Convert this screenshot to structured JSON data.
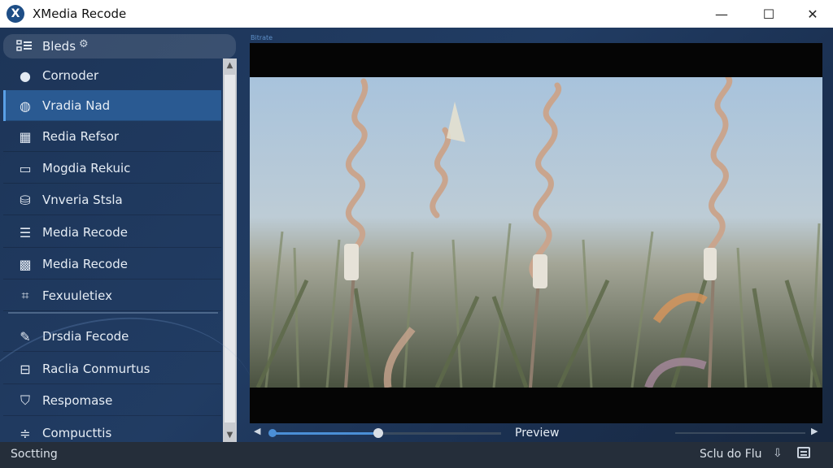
{
  "window": {
    "title": "XMedia Recode",
    "logo_glyph": "X",
    "controls": {
      "minimize": "—",
      "maximize": "☐",
      "close": "✕"
    }
  },
  "sidebar": {
    "header": {
      "label": "Bleds",
      "icon": "list-icon",
      "gear_icon": "gear-icon"
    },
    "items": [
      {
        "label": "Cornoder",
        "icon": "circle-icon",
        "glyph": "●"
      },
      {
        "label": "Vradia Nad",
        "icon": "sphere-icon",
        "glyph": "◍",
        "active": true
      },
      {
        "label": "Redia Refsor",
        "icon": "grid-icon",
        "glyph": "▦"
      },
      {
        "label": "Mogdia Rekuic",
        "icon": "monitor-icon",
        "glyph": "▭"
      },
      {
        "label": "Vnveria Stsla",
        "icon": "database-icon",
        "glyph": "⛁"
      },
      {
        "label": "Media Recode",
        "icon": "layers-icon",
        "glyph": "☰"
      },
      {
        "label": "Media Recode",
        "icon": "tiles-icon",
        "glyph": "▩"
      },
      {
        "label": "Fexuuletiex",
        "icon": "chip-icon",
        "glyph": "⌗"
      },
      {
        "label": "Drsdia Fecode",
        "icon": "wrench-icon",
        "glyph": "✎"
      },
      {
        "label": "Raclia Conmurtus",
        "icon": "drive-icon",
        "glyph": "⊟"
      },
      {
        "label": "Respomase",
        "icon": "shield-icon",
        "glyph": "⛉"
      },
      {
        "label": "Compucttis",
        "icon": "sliders-icon",
        "glyph": "≑"
      }
    ],
    "scroll": {
      "up": "▲",
      "down": "▼"
    }
  },
  "preview": {
    "tiny_label": "Bitrate",
    "label": "Preview",
    "prev_glyph": "◀",
    "next_glyph": "▶",
    "progress": 0.46
  },
  "status": {
    "left": "Soctting",
    "right": "Sclu do  Flu",
    "icons": [
      "download-icon",
      "window-icon"
    ]
  },
  "colors": {
    "accent": "#4b8fd6",
    "active_item": "#2a5a92",
    "logo": "#1e4e86"
  }
}
